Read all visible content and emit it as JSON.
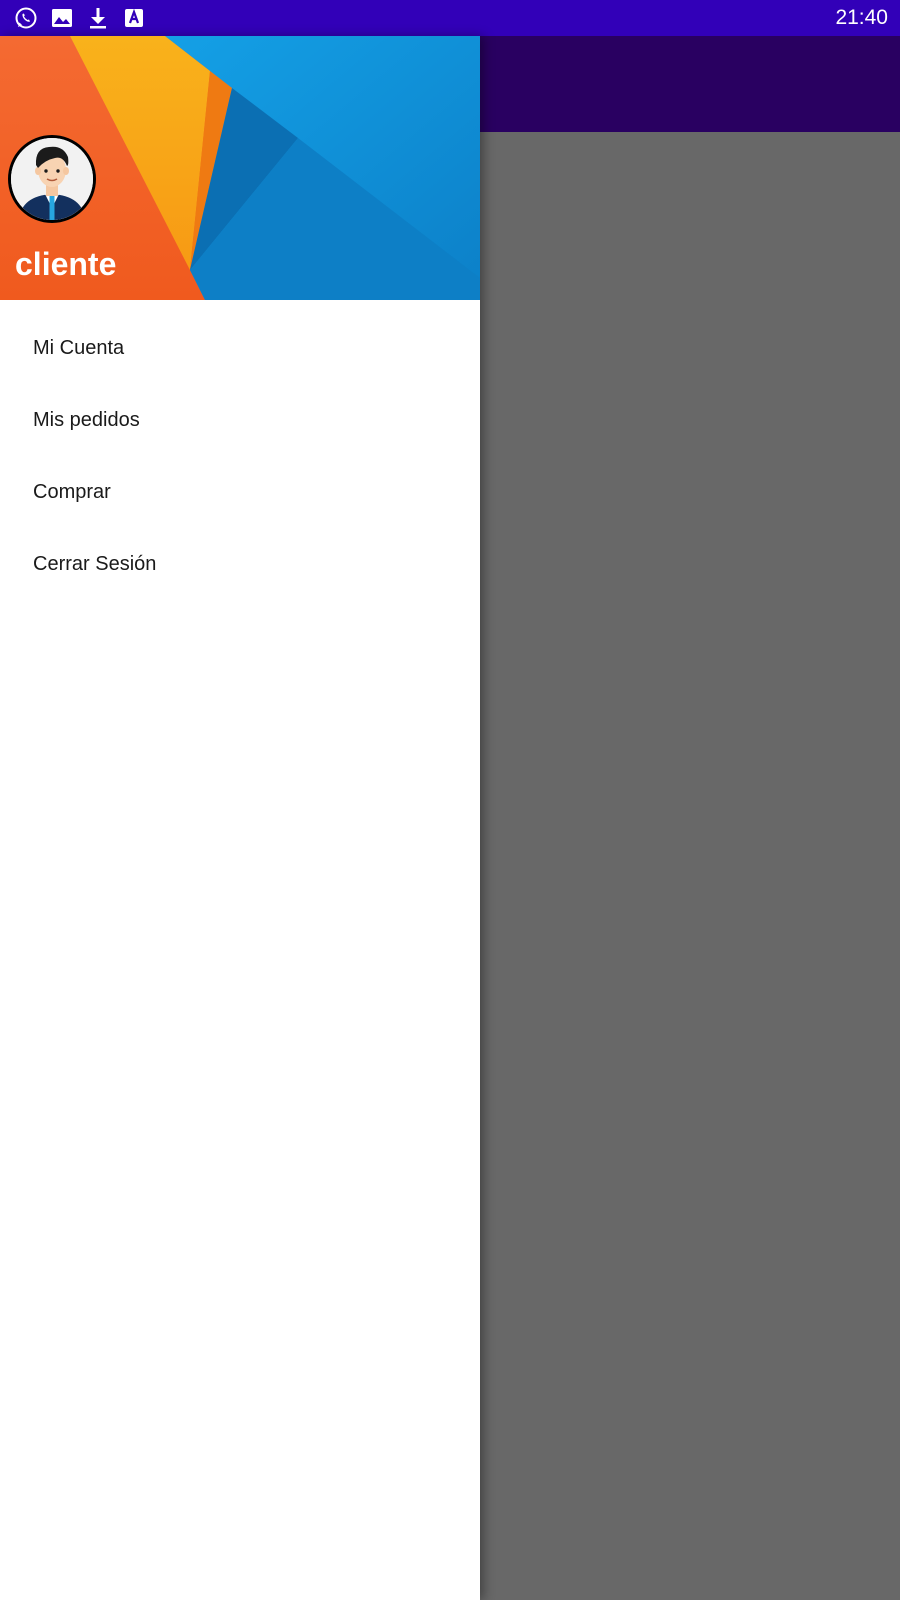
{
  "status_bar": {
    "icons": [
      "whatsapp-icon",
      "image-icon",
      "download-icon",
      "translate-icon"
    ],
    "time": "21:40",
    "color": "#3200b8"
  },
  "app_bar": {
    "color": "#290061"
  },
  "drawer": {
    "header": {
      "avatar": "avatar-person-icon",
      "user_name": "cliente"
    },
    "menu": [
      {
        "label": "Mi Cuenta"
      },
      {
        "label": "Mis pedidos"
      },
      {
        "label": "Comprar"
      },
      {
        "label": "Cerrar Sesión"
      }
    ]
  },
  "scrim_color": "#686868"
}
